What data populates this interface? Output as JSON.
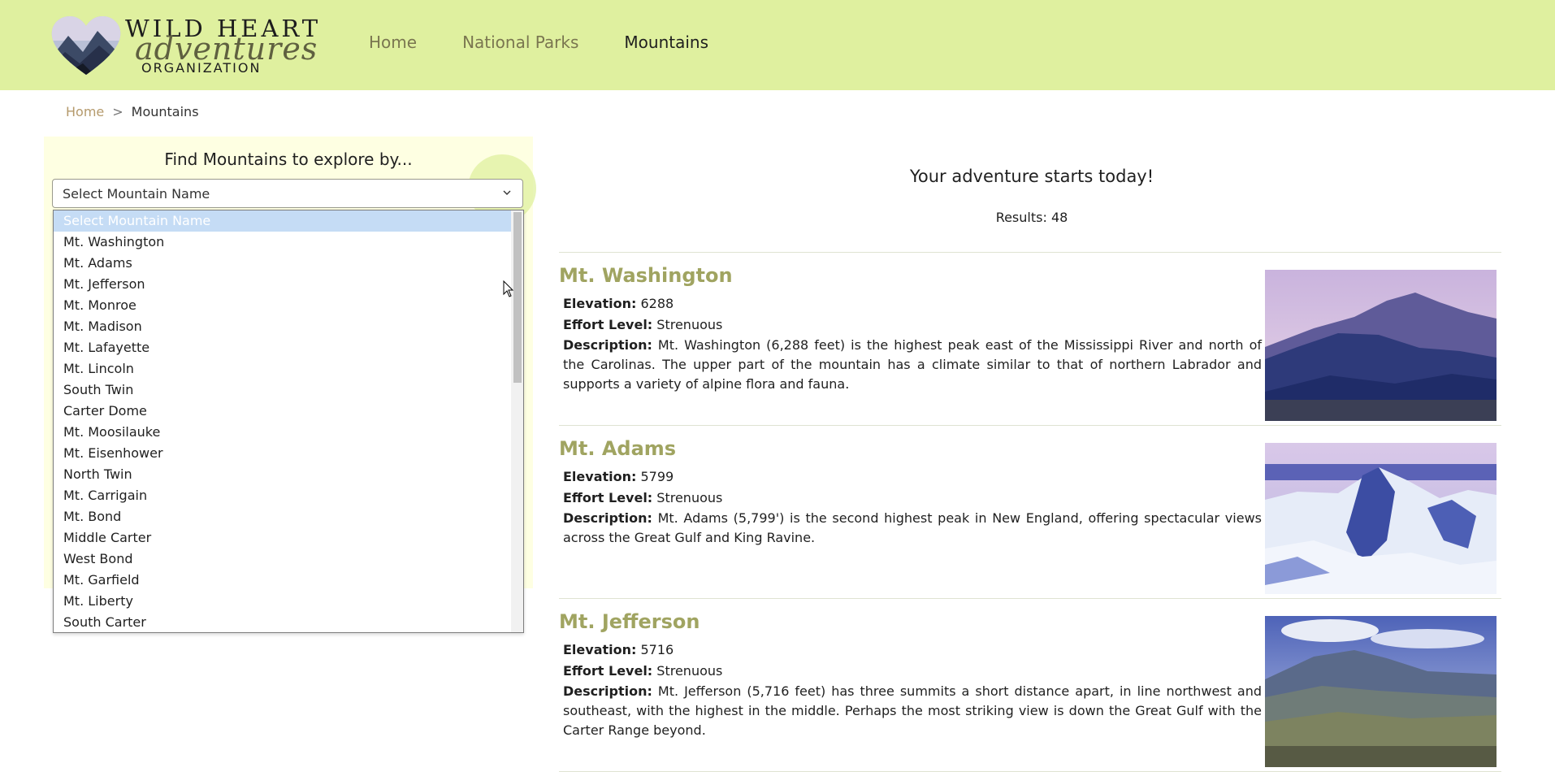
{
  "brand": {
    "line1": "WILD HEART",
    "line2": "adventures",
    "line3": "ORGANIZATION"
  },
  "nav": {
    "items": [
      {
        "label": "Home",
        "active": false
      },
      {
        "label": "National Parks",
        "active": false
      },
      {
        "label": "Mountains",
        "active": true
      }
    ]
  },
  "breadcrumb": {
    "home": "Home",
    "separator": ">",
    "current": "Mountains"
  },
  "filter": {
    "title": "Find Mountains to explore by...",
    "select_value": "Select Mountain Name",
    "options": [
      "Select Mountain Name",
      "Mt. Washington",
      "Mt. Adams",
      "Mt. Jefferson",
      "Mt. Monroe",
      "Mt. Madison",
      "Mt. Lafayette",
      "Mt. Lincoln",
      "South Twin",
      "Carter Dome",
      "Mt. Moosilauke",
      "Mt. Eisenhower",
      "North Twin",
      "Mt. Carrigain",
      "Mt. Bond",
      "Middle Carter",
      "West Bond",
      "Mt. Garfield",
      "Mt. Liberty",
      "South Carter"
    ]
  },
  "results": {
    "heading": "Your adventure starts today!",
    "count_label": "Results: 48",
    "labels": {
      "elevation": "Elevation:",
      "effort": "Effort Level:",
      "description": "Description:"
    },
    "items": [
      {
        "name": "Mt. Washington",
        "elevation": "6288",
        "effort": "Strenuous",
        "description": "Mt. Washington (6,288 feet) is the highest peak east of the Mississippi River and north of the Carolinas. The upper part of the mountain has a climate similar to that of northern Labrador and supports a variety of alpine flora and fauna."
      },
      {
        "name": "Mt. Adams",
        "elevation": "5799",
        "effort": "Strenuous",
        "description": "Mt. Adams (5,799') is the second highest peak in New England, offering spectacular views across the Great Gulf and King Ravine."
      },
      {
        "name": "Mt. Jefferson",
        "elevation": "5716",
        "effort": "Strenuous",
        "description": "Mt. Jefferson (5,716 feet) has three summits a short distance apart, in line northwest and southeast, with the highest in the middle. Perhaps the most striking view is down the Great Gulf with the Carter Range beyond."
      }
    ]
  },
  "colors": {
    "header_bg": "#dff09f",
    "accent": "#a0a461",
    "panel_bg": "#feffe2"
  }
}
